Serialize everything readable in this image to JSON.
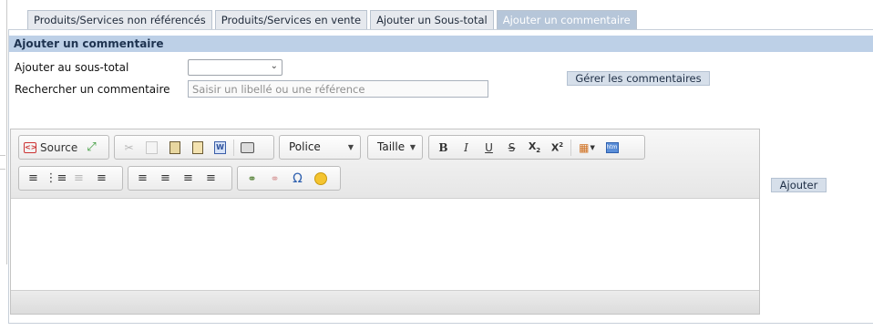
{
  "tabs": [
    {
      "label": "Produits/Services non référencés",
      "active": false
    },
    {
      "label": "Produits/Services en vente",
      "active": false
    },
    {
      "label": "Ajouter un Sous-total",
      "active": false
    },
    {
      "label": "Ajouter un commentaire",
      "active": true
    }
  ],
  "panel": {
    "title": "Ajouter un commentaire",
    "subtotal_label": "Ajouter au sous-total",
    "subtotal_value": "",
    "search_label": "Rechercher un commentaire",
    "search_value": "",
    "search_placeholder": "Saisir un libellé ou une référence",
    "manage_button": "Gérer les commentaires",
    "add_button": "Ajouter"
  },
  "editor": {
    "source_label": "Source",
    "font_combo": "Police",
    "size_combo": "Taille",
    "bold": "B",
    "italic": "I",
    "underline": "U",
    "strike": "S",
    "omega": "Ω",
    "content": ""
  },
  "colors": {
    "tab_active_bg": "#b6c6d9",
    "title_bar_bg": "#bdd0e7",
    "button_bg": "#d6dfea"
  }
}
